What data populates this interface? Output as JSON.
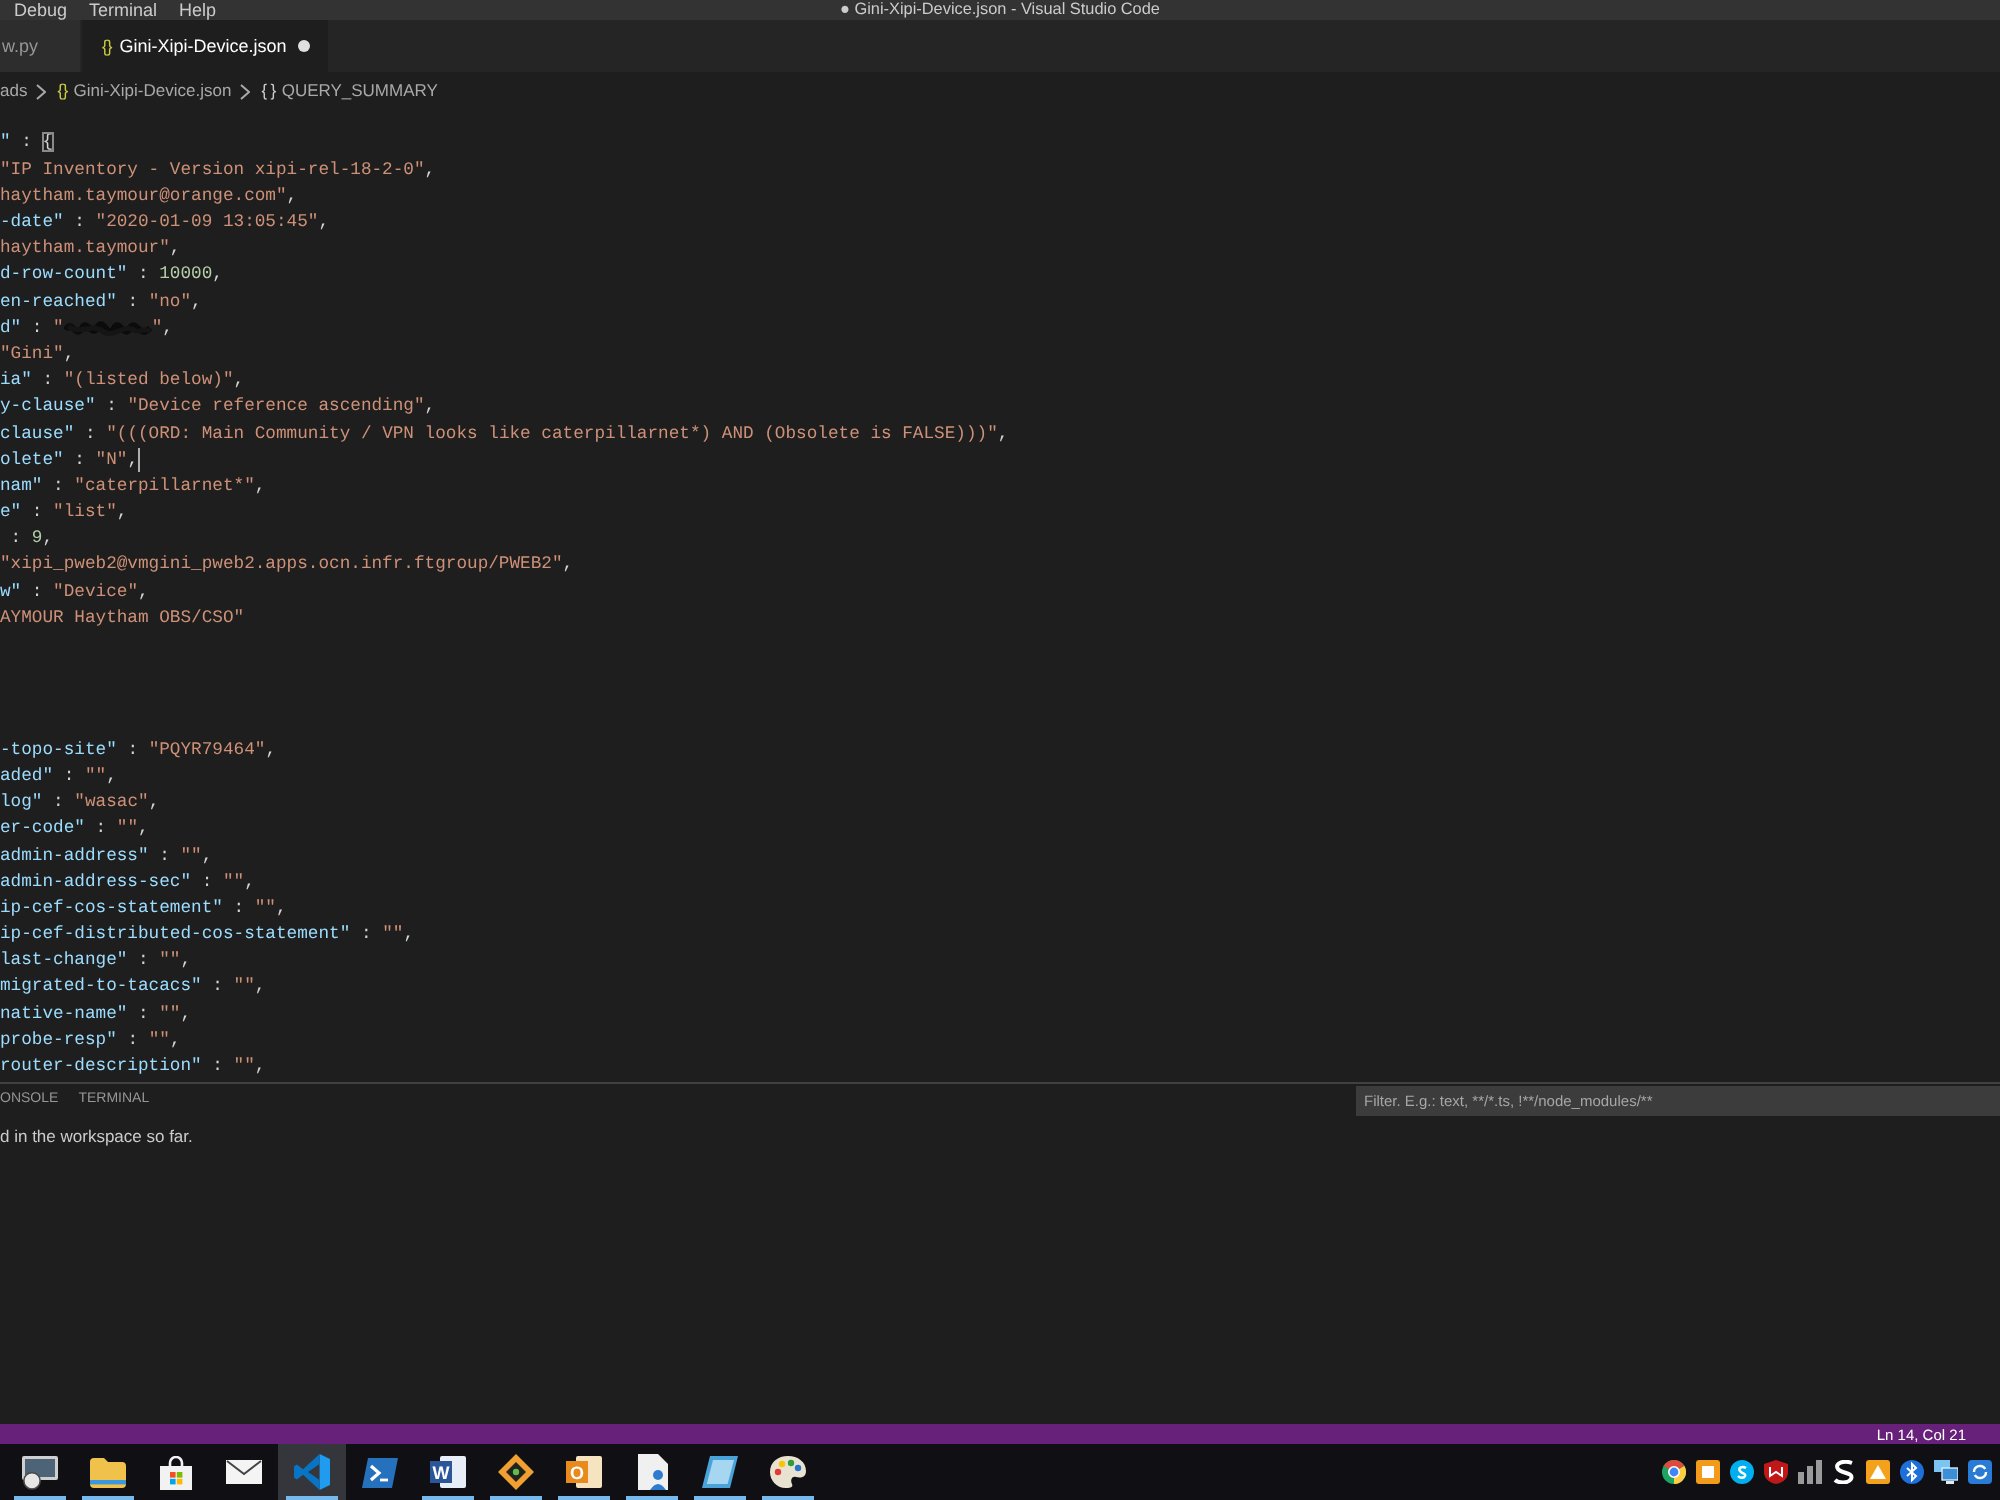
{
  "menu_bar": {
    "items": [
      "Debug",
      "Terminal",
      "Help"
    ]
  },
  "window": {
    "title": "● Gini-Xipi-Device.json - Visual Studio Code"
  },
  "tabs": [
    {
      "label": "w.py",
      "selected": false,
      "modified": false
    },
    {
      "icon": "{}",
      "label": "Gini-Xipi-Device.json",
      "selected": true,
      "modified": true
    }
  ],
  "breadcrumbs": [
    {
      "kind": "folder",
      "label": "ads"
    },
    {
      "kind": "file",
      "icon": "{}",
      "label": "Gini-Xipi-Device.json"
    },
    {
      "kind": "symbol",
      "icon": "{ }",
      "label": "QUERY_SUMMARY"
    }
  ],
  "editor": {
    "lines": [
      {
        "kind": "code",
        "cursor": false,
        "segments": [
          {
            "kind": "key",
            "text": "\""
          },
          {
            "kind": "punct",
            "text": " : "
          },
          {
            "kind": "bracket",
            "text": "{"
          }
        ]
      },
      {
        "kind": "code",
        "cursor": false,
        "segments": [
          {
            "kind": "string",
            "text": "\"IP Inventory - Version xipi-rel-18-2-0\""
          },
          {
            "kind": "punct",
            "text": ","
          }
        ]
      },
      {
        "kind": "code",
        "cursor": false,
        "segments": [
          {
            "kind": "string",
            "text": "haytham.taymour@orange.com\""
          },
          {
            "kind": "punct",
            "text": ","
          }
        ]
      },
      {
        "kind": "code",
        "cursor": false,
        "segments": [
          {
            "kind": "key",
            "text": "-date\""
          },
          {
            "kind": "punct",
            "text": " : "
          },
          {
            "kind": "string",
            "text": "\"2020-01-09 13:05:45\""
          },
          {
            "kind": "punct",
            "text": ","
          }
        ]
      },
      {
        "kind": "code",
        "cursor": false,
        "segments": [
          {
            "kind": "string",
            "text": "haytham.taymour\""
          },
          {
            "kind": "punct",
            "text": ","
          }
        ]
      },
      {
        "kind": "code",
        "cursor": false,
        "segments": [
          {
            "kind": "key",
            "text": "d-row-count\""
          },
          {
            "kind": "punct",
            "text": " : "
          },
          {
            "kind": "number",
            "text": "10000"
          },
          {
            "kind": "punct",
            "text": ","
          }
        ]
      },
      {
        "kind": "code",
        "cursor": false,
        "segments": [
          {
            "kind": "key",
            "text": "en-reached\""
          },
          {
            "kind": "punct",
            "text": " : "
          },
          {
            "kind": "string",
            "text": "\"no\""
          },
          {
            "kind": "punct",
            "text": ","
          }
        ]
      },
      {
        "kind": "code",
        "cursor": false,
        "segments": [
          {
            "kind": "key",
            "text": "d\""
          },
          {
            "kind": "punct",
            "text": " : "
          },
          {
            "kind": "string",
            "text": "\""
          },
          {
            "kind": "redaction"
          },
          {
            "kind": "string",
            "text": "\""
          },
          {
            "kind": "punct",
            "text": ","
          }
        ]
      },
      {
        "kind": "code",
        "cursor": false,
        "segments": [
          {
            "kind": "string",
            "text": "\"Gini\""
          },
          {
            "kind": "punct",
            "text": ","
          }
        ]
      },
      {
        "kind": "code",
        "cursor": false,
        "segments": [
          {
            "kind": "key",
            "text": "ia\""
          },
          {
            "kind": "punct",
            "text": " : "
          },
          {
            "kind": "string",
            "text": "\"(listed below)\""
          },
          {
            "kind": "punct",
            "text": ","
          }
        ]
      },
      {
        "kind": "code",
        "cursor": false,
        "segments": [
          {
            "kind": "key",
            "text": "y-clause\""
          },
          {
            "kind": "punct",
            "text": " : "
          },
          {
            "kind": "string",
            "text": "\"Device reference ascending\""
          },
          {
            "kind": "punct",
            "text": ","
          }
        ]
      },
      {
        "kind": "code",
        "cursor": false,
        "segments": [
          {
            "kind": "key",
            "text": "clause\""
          },
          {
            "kind": "punct",
            "text": " : "
          },
          {
            "kind": "string",
            "text": "\"(((ORD: Main Community / VPN looks like caterpillarnet*) AND (Obsolete is FALSE)))\""
          },
          {
            "kind": "punct",
            "text": ","
          }
        ]
      },
      {
        "kind": "code",
        "cursor": true,
        "segments": [
          {
            "kind": "key",
            "text": "olete\""
          },
          {
            "kind": "punct",
            "text": " : "
          },
          {
            "kind": "string",
            "text": "\"N\""
          },
          {
            "kind": "punct",
            "text": ","
          }
        ]
      },
      {
        "kind": "code",
        "cursor": false,
        "segments": [
          {
            "kind": "key",
            "text": "nam\""
          },
          {
            "kind": "punct",
            "text": " : "
          },
          {
            "kind": "string",
            "text": "\"caterpillarnet*\""
          },
          {
            "kind": "punct",
            "text": ","
          }
        ]
      },
      {
        "kind": "code",
        "cursor": false,
        "segments": [
          {
            "kind": "key",
            "text": "e\""
          },
          {
            "kind": "punct",
            "text": " : "
          },
          {
            "kind": "string",
            "text": "\"list\""
          },
          {
            "kind": "punct",
            "text": ","
          }
        ]
      },
      {
        "kind": "code",
        "cursor": false,
        "segments": [
          {
            "kind": "punct",
            "text": " : "
          },
          {
            "kind": "number",
            "text": "9"
          },
          {
            "kind": "punct",
            "text": ","
          }
        ]
      },
      {
        "kind": "code",
        "cursor": false,
        "segments": [
          {
            "kind": "string",
            "text": "\"xipi_pweb2@vmgini_pweb2.apps.ocn.infr.ftgroup/PWEB2\""
          },
          {
            "kind": "punct",
            "text": ","
          }
        ]
      },
      {
        "kind": "code",
        "cursor": false,
        "segments": [
          {
            "kind": "key",
            "text": "w\""
          },
          {
            "kind": "punct",
            "text": " : "
          },
          {
            "kind": "string",
            "text": "\"Device\""
          },
          {
            "kind": "punct",
            "text": ","
          }
        ]
      },
      {
        "kind": "code",
        "cursor": false,
        "segments": [
          {
            "kind": "string",
            "text": "AYMOUR Haytham OBS/CSO\""
          }
        ]
      },
      {
        "kind": "blank",
        "cursor": false
      },
      {
        "kind": "blank",
        "cursor": false
      },
      {
        "kind": "blank",
        "cursor": false
      },
      {
        "kind": "blank",
        "cursor": false
      },
      {
        "kind": "code",
        "cursor": false,
        "segments": [
          {
            "kind": "key",
            "text": "-topo-site\""
          },
          {
            "kind": "punct",
            "text": " : "
          },
          {
            "kind": "string",
            "text": "\"PQYR79464\""
          },
          {
            "kind": "punct",
            "text": ","
          }
        ]
      },
      {
        "kind": "code",
        "cursor": false,
        "segments": [
          {
            "kind": "key",
            "text": "aded\""
          },
          {
            "kind": "punct",
            "text": " : "
          },
          {
            "kind": "string",
            "text": "\"\""
          },
          {
            "kind": "punct",
            "text": ","
          }
        ]
      },
      {
        "kind": "code",
        "cursor": false,
        "segments": [
          {
            "kind": "key",
            "text": "log\""
          },
          {
            "kind": "punct",
            "text": " : "
          },
          {
            "kind": "string",
            "text": "\"wasac\""
          },
          {
            "kind": "punct",
            "text": ","
          }
        ]
      },
      {
        "kind": "code",
        "cursor": false,
        "segments": [
          {
            "kind": "key",
            "text": "er-code\""
          },
          {
            "kind": "punct",
            "text": " : "
          },
          {
            "kind": "string",
            "text": "\"\""
          },
          {
            "kind": "punct",
            "text": ","
          }
        ]
      },
      {
        "kind": "code",
        "cursor": false,
        "segments": [
          {
            "kind": "key",
            "text": "admin-address\""
          },
          {
            "kind": "punct",
            "text": " : "
          },
          {
            "kind": "string",
            "text": "\"\""
          },
          {
            "kind": "punct",
            "text": ","
          }
        ]
      },
      {
        "kind": "code",
        "cursor": false,
        "segments": [
          {
            "kind": "key",
            "text": "admin-address-sec\""
          },
          {
            "kind": "punct",
            "text": " : "
          },
          {
            "kind": "string",
            "text": "\"\""
          },
          {
            "kind": "punct",
            "text": ","
          }
        ]
      },
      {
        "kind": "code",
        "cursor": false,
        "segments": [
          {
            "kind": "key",
            "text": "ip-cef-cos-statement\""
          },
          {
            "kind": "punct",
            "text": " : "
          },
          {
            "kind": "string",
            "text": "\"\""
          },
          {
            "kind": "punct",
            "text": ","
          }
        ]
      },
      {
        "kind": "code",
        "cursor": false,
        "segments": [
          {
            "kind": "key",
            "text": "ip-cef-distributed-cos-statement\""
          },
          {
            "kind": "punct",
            "text": " : "
          },
          {
            "kind": "string",
            "text": "\"\""
          },
          {
            "kind": "punct",
            "text": ","
          }
        ]
      },
      {
        "kind": "code",
        "cursor": false,
        "segments": [
          {
            "kind": "key",
            "text": "last-change\""
          },
          {
            "kind": "punct",
            "text": " : "
          },
          {
            "kind": "string",
            "text": "\"\""
          },
          {
            "kind": "punct",
            "text": ","
          }
        ]
      },
      {
        "kind": "code",
        "cursor": false,
        "segments": [
          {
            "kind": "key",
            "text": "migrated-to-tacacs\""
          },
          {
            "kind": "punct",
            "text": " : "
          },
          {
            "kind": "string",
            "text": "\"\""
          },
          {
            "kind": "punct",
            "text": ","
          }
        ]
      },
      {
        "kind": "code",
        "cursor": false,
        "segments": [
          {
            "kind": "key",
            "text": "native-name\""
          },
          {
            "kind": "punct",
            "text": " : "
          },
          {
            "kind": "string",
            "text": "\"\""
          },
          {
            "kind": "punct",
            "text": ","
          }
        ]
      },
      {
        "kind": "code",
        "cursor": false,
        "segments": [
          {
            "kind": "key",
            "text": "probe-resp\""
          },
          {
            "kind": "punct",
            "text": " : "
          },
          {
            "kind": "string",
            "text": "\"\""
          },
          {
            "kind": "punct",
            "text": ","
          }
        ]
      },
      {
        "kind": "code",
        "cursor": false,
        "segments": [
          {
            "kind": "key",
            "text": "router-description\""
          },
          {
            "kind": "punct",
            "text": " : "
          },
          {
            "kind": "string",
            "text": "\"\""
          },
          {
            "kind": "punct",
            "text": ","
          }
        ]
      }
    ]
  },
  "panel": {
    "tabs": [
      {
        "label": "ONSOLE",
        "selected": false
      },
      {
        "label": "TERMINAL",
        "selected": false
      }
    ],
    "filter": {
      "placeholder": "Filter. E.g.: text, **/*.ts, !**/node_modules/**"
    },
    "message": "d in the workspace so far."
  },
  "status_bar": {
    "items": [
      "Ln 14, Col 21"
    ]
  },
  "taskbar": {
    "apps": [
      {
        "kind": "window",
        "running": true,
        "selected": false
      },
      {
        "kind": "folder",
        "running": true,
        "selected": false
      },
      {
        "kind": "bag",
        "running": false,
        "selected": false
      },
      {
        "kind": "envelope",
        "running": false,
        "selected": false
      },
      {
        "kind": "ribbon",
        "running": true,
        "selected": true
      },
      {
        "kind": "terminal",
        "running": false,
        "selected": false
      },
      {
        "kind": "word_tile",
        "glyph": "W",
        "running": true,
        "selected": false
      },
      {
        "kind": "diamond",
        "running": true,
        "selected": false
      },
      {
        "kind": "mail_tile",
        "glyph": "O",
        "running": true,
        "selected": false
      },
      {
        "kind": "document",
        "running": true,
        "selected": false
      },
      {
        "kind": "book",
        "running": true,
        "selected": false
      },
      {
        "kind": "palette",
        "running": true,
        "selected": false
      }
    ],
    "tray": [
      {
        "kind": "ball"
      },
      {
        "kind": "tile"
      },
      {
        "kind": "badge"
      },
      {
        "kind": "shield"
      },
      {
        "kind": "bars"
      },
      {
        "kind": "zigzag"
      },
      {
        "kind": "alert_tile"
      },
      {
        "kind": "bluetooth"
      },
      {
        "kind": "monitor"
      },
      {
        "kind": "sync"
      }
    ]
  }
}
